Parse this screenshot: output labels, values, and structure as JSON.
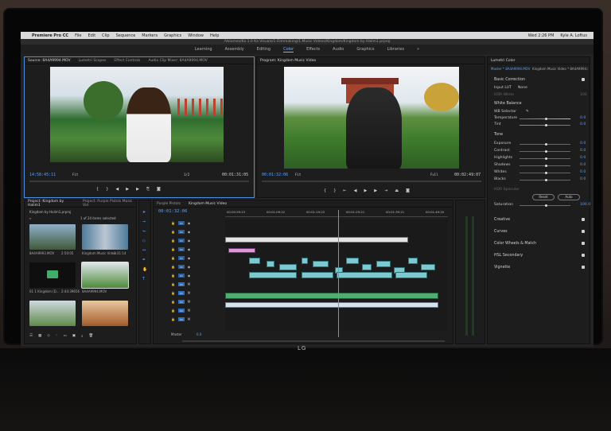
{
  "menubar": {
    "app": "Premiere Pro CC",
    "items": [
      "File",
      "Edit",
      "Clip",
      "Sequence",
      "Markers",
      "Graphics",
      "Window",
      "Help"
    ],
    "clock": "Wed 2:26 PM",
    "user": "Kyle A. Loftus"
  },
  "window_title": "/Volumes/Ka 1.0 Ka Visuals/1.Filmmaking/1.Music Videos/Kingdom/Kingdom by Halim1.prproj",
  "workspaces": [
    "Learning",
    "Assembly",
    "Editing",
    "Color",
    "Effects",
    "Audio",
    "Graphics",
    "Libraries"
  ],
  "active_workspace": "Color",
  "source": {
    "tabs": [
      "Source: 8A4A9994.MOV",
      "Lumetri Scopes",
      "Effect Controls",
      "Audio Clip Mixer: 8A4A9994.MOV"
    ],
    "timecode": "14:58:45:11",
    "fit": "Fit",
    "scale": "1/2",
    "duration": "00:01:31:05"
  },
  "program": {
    "tab": "Program: Kingdom Music Video",
    "timecode": "00:01:32:06",
    "fit": "Fit",
    "scale": "Full",
    "duration": "00:02:49:07"
  },
  "project": {
    "tabs": [
      "Project: Kingdom by Halim1",
      "Project: Purple Pistols Music Vid"
    ],
    "path": "Kingdom by Halim1.prproj",
    "count": "1 of 24 items selected",
    "items": [
      {
        "name": "8A4A9993.MOV",
        "dur": "2:50:05"
      },
      {
        "name": "Kingdom Music Video",
        "dur": "3:31:14"
      },
      {
        "name": "01 1 Kingdom (D...",
        "dur": "2:44:39656"
      },
      {
        "name": "8A4A9994.MOV",
        "dur": ""
      },
      {
        "name": "",
        "dur": ""
      },
      {
        "name": "",
        "dur": ""
      }
    ]
  },
  "timeline": {
    "tabs": [
      "Purple Pistols",
      "Kingdom Music Video"
    ],
    "timecode": "00:01:32:06",
    "ruler": [
      "00:00:59:23",
      "00:01:09:22",
      "00:01:19:22",
      "00:01:29:21",
      "00:01:39:21",
      "00:01:49:20"
    ],
    "master_label": "Master",
    "master_value": "0.0"
  },
  "lumetri": {
    "tabs": [
      "Lumetri Color"
    ],
    "master_label": "Master * 8A4A9994.MOV",
    "clip_label": "Kingdom Music Video * 8A4A9994.MOV",
    "basic_correction": "Basic Correction",
    "input_lut_label": "Input LUT",
    "input_lut_value": "None",
    "hdr_white": "HDR White",
    "hdr_white_value": "100",
    "white_balance": "White Balance",
    "wb_selector": "WB Selector",
    "tone": "Tone",
    "hdr_specular": "HDR Specular",
    "reset_label": "Reset",
    "auto_label": "Auto",
    "rows": [
      {
        "label": "Temperature",
        "value": "0.0"
      },
      {
        "label": "Tint",
        "value": "0.0"
      },
      {
        "label": "Exposure",
        "value": "0.0"
      },
      {
        "label": "Contrast",
        "value": "0.0"
      },
      {
        "label": "Highlights",
        "value": "0.0"
      },
      {
        "label": "Shadows",
        "value": "0.0"
      },
      {
        "label": "Whites",
        "value": "0.0"
      },
      {
        "label": "Blacks",
        "value": "0.0"
      }
    ],
    "saturation_label": "Saturation",
    "saturation_value": "100.0",
    "sections": [
      "Creative",
      "Curves",
      "Color Wheels & Match",
      "HSL Secondary",
      "Vignette"
    ]
  },
  "monitor_brand": "LG"
}
